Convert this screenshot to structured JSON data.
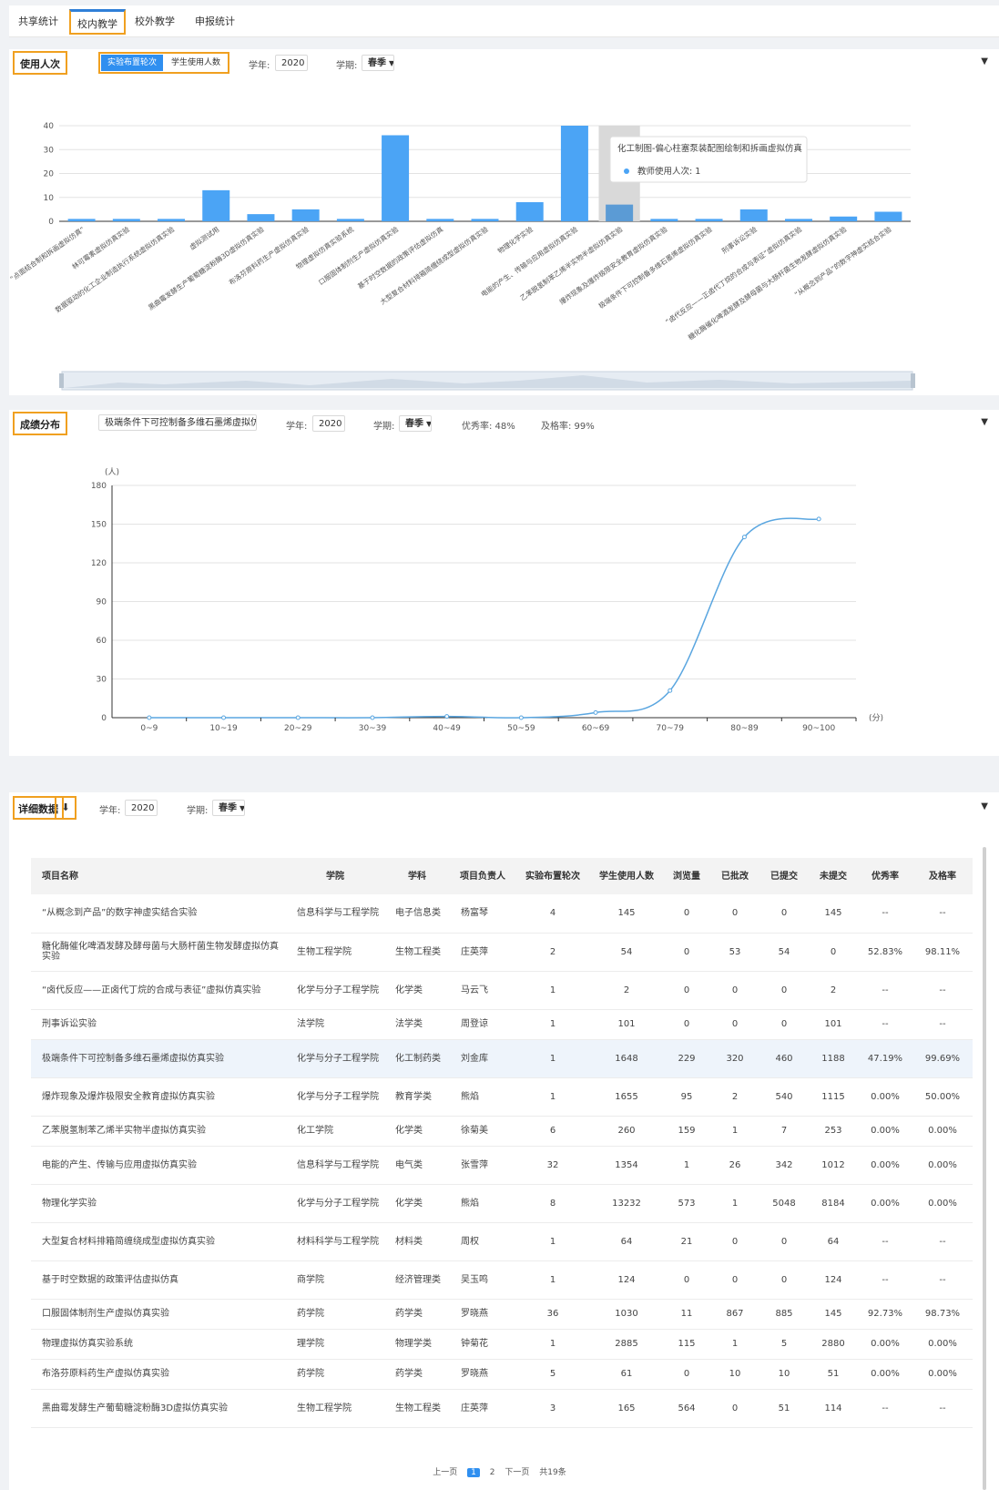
{
  "tabs": [
    {
      "label": "共享统计"
    },
    {
      "label": "校内教学"
    },
    {
      "label": "校外教学"
    },
    {
      "label": "申报统计"
    }
  ],
  "usage": {
    "title": "使用人次",
    "toggle": [
      "实验布置轮次",
      "学生使用人数"
    ],
    "year_label": "学年:",
    "year": "2020",
    "term_label": "学期:",
    "term": "春季",
    "tooltip_title": "化工制图-偏心柱塞泵装配图绘制和拆画虚拟仿真",
    "tooltip_item": "教师使用人次: 1"
  },
  "grades": {
    "title": "成绩分布",
    "project": "极端条件下可控制备多维石墨烯虚拟仿真...",
    "year_label": "学年:",
    "year": "2020",
    "term_label": "学期:",
    "term": "春季",
    "excellent": "优秀率: 48%",
    "pass": "及格率: 99%"
  },
  "details": {
    "title": "详细数据",
    "download_icon": "download-icon",
    "year_label": "学年:",
    "year": "2020",
    "term_label": "学期:",
    "term": "春季",
    "headers": [
      "项目名称",
      "学院",
      "学科",
      "项目负责人",
      "实验布置轮次",
      "学生使用人数",
      "浏览量",
      "已批改",
      "已提交",
      "未提交",
      "优秀率",
      "及格率"
    ],
    "rows": [
      [
        "“从概念到产品”的数字神虚实结合实验",
        "信息科学与工程学院",
        "电子信息类",
        "杨富琴",
        "4",
        "145",
        "0",
        "0",
        "0",
        "145",
        "--",
        "--"
      ],
      [
        "糖化酶催化啤酒发酵及酵母菌与大肠杆菌生物发酵虚拟仿真实验",
        "生物工程学院",
        "生物工程类",
        "庄英萍",
        "2",
        "54",
        "0",
        "53",
        "54",
        "0",
        "52.83%",
        "98.11%"
      ],
      [
        "“卤代反应——正卤代丁烷的合成与表征”虚拟仿真实验",
        "化学与分子工程学院",
        "化学类",
        "马云飞",
        "1",
        "2",
        "0",
        "0",
        "0",
        "2",
        "--",
        "--"
      ],
      [
        "刑事诉讼实验",
        "法学院",
        "法学类",
        "周登谅",
        "1",
        "101",
        "0",
        "0",
        "0",
        "101",
        "--",
        "--"
      ],
      [
        "极端条件下可控制备多维石墨烯虚拟仿真实验",
        "化学与分子工程学院",
        "化工制药类",
        "刘金库",
        "1",
        "1648",
        "229",
        "320",
        "460",
        "1188",
        "47.19%",
        "99.69%"
      ],
      [
        "爆炸现象及爆炸极限安全教育虚拟仿真实验",
        "化学与分子工程学院",
        "教育学类",
        "熊焰",
        "1",
        "1655",
        "95",
        "2",
        "540",
        "1115",
        "0.00%",
        "50.00%"
      ],
      [
        "乙苯脱氢制苯乙烯半实物半虚拟仿真实验",
        "化工学院",
        "化学类",
        "徐菊美",
        "6",
        "260",
        "159",
        "1",
        "7",
        "253",
        "0.00%",
        "0.00%"
      ],
      [
        "电能的产生、传输与应用虚拟仿真实验",
        "信息科学与工程学院",
        "电气类",
        "张雪萍",
        "32",
        "1354",
        "1",
        "26",
        "342",
        "1012",
        "0.00%",
        "0.00%"
      ],
      [
        "物理化学实验",
        "化学与分子工程学院",
        "化学类",
        "熊焰",
        "8",
        "13232",
        "573",
        "1",
        "5048",
        "8184",
        "0.00%",
        "0.00%"
      ],
      [
        "大型复合材料排箱简缠绕成型虚拟仿真实验",
        "材料科学与工程学院",
        "材料类",
        "周权",
        "1",
        "64",
        "21",
        "0",
        "0",
        "64",
        "--",
        "--"
      ],
      [
        "基于时空数据的政策评估虚拟仿真",
        "商学院",
        "经济管理类",
        "吴玉鸣",
        "1",
        "124",
        "0",
        "0",
        "0",
        "124",
        "--",
        "--"
      ],
      [
        "口服固体制剂生产虚拟仿真实验",
        "药学院",
        "药学类",
        "罗晓燕",
        "36",
        "1030",
        "11",
        "867",
        "885",
        "145",
        "92.73%",
        "98.73%"
      ],
      [
        "物理虚拟仿真实验系统",
        "理学院",
        "物理学类",
        "钟菊花",
        "1",
        "2885",
        "115",
        "1",
        "5",
        "2880",
        "0.00%",
        "0.00%"
      ],
      [
        "布洛芬原料药生产虚拟仿真实验",
        "药学院",
        "药学类",
        "罗晓燕",
        "5",
        "61",
        "0",
        "10",
        "10",
        "51",
        "0.00%",
        "0.00%"
      ],
      [
        "黑曲霉发酵生产葡萄糖淀粉酶3D虚拟仿真实验",
        "生物工程学院",
        "生物工程类",
        "庄英萍",
        "3",
        "165",
        "564",
        "0",
        "51",
        "114",
        "--",
        "--"
      ]
    ]
  },
  "pager": {
    "prev": "上一页",
    "pages": [
      "1",
      "2"
    ],
    "next": "下一页",
    "total": "共19条"
  },
  "chart_data": [
    {
      "type": "bar",
      "categories": [
        "“点面结合制和拆画虚拟仿真”",
        "林可霉素虚拟仿真实验",
        "数据驱动的化工企业制造执行系统虚拟仿真实验",
        "虚拟测试用",
        "黑曲霉发酵生产葡萄糖淀粉酶3D虚拟仿真实验",
        "布洛芬原料药生产虚拟仿真实验",
        "物理虚拟仿真实验系统",
        "口服固体制剂生产虚拟仿真实验",
        "基于时空数据的政策评估虚拟仿真",
        "大型复合材料排箱简缠绕成型虚拟仿真实验",
        "物理化学实验",
        "电能的产生、传输与应用虚拟仿真实验",
        "乙苯脱氢制苯乙烯半实物半虚拟仿真实验",
        "爆炸现象及爆炸极限安全教育虚拟仿真实验",
        "极端条件下可控制备多维石墨烯虚拟仿真实验",
        "刑事诉讼实验",
        "“卤代反应——正卤代丁烷的合成与表征”虚拟仿真实验",
        "糖化酶催化啤酒发酵及酵母菌与大肠杆菌生物发酵虚拟仿真实验",
        "“从概念到产品”的数字神虚实结合实验"
      ],
      "values": [
        1,
        1,
        1,
        13,
        3,
        5,
        1,
        36,
        1,
        1,
        8,
        40,
        7,
        1,
        1,
        5,
        1,
        2,
        4
      ],
      "highlight_index": 12,
      "ylim": [
        0,
        40
      ],
      "yticks": [
        0,
        10,
        20,
        30,
        40
      ],
      "title": "",
      "xlabel": "",
      "ylabel": "",
      "grid": true,
      "color": "#4ba4f5",
      "highlight_color": "#5b9bd5"
    },
    {
      "type": "line",
      "categories": [
        "0~9",
        "10~19",
        "20~29",
        "30~39",
        "40~49",
        "50~59",
        "60~69",
        "70~79",
        "80~89",
        "90~100"
      ],
      "values": [
        0,
        0,
        0,
        0,
        1,
        0,
        4,
        21,
        140,
        154
      ],
      "ylim": [
        0,
        180
      ],
      "yticks": [
        0,
        30,
        60,
        90,
        120,
        150,
        180
      ],
      "yunit": "(人)",
      "xunit": "(分)",
      "title": "",
      "xlabel": "",
      "ylabel": "",
      "grid": true,
      "color": "#5aa6e0"
    }
  ]
}
